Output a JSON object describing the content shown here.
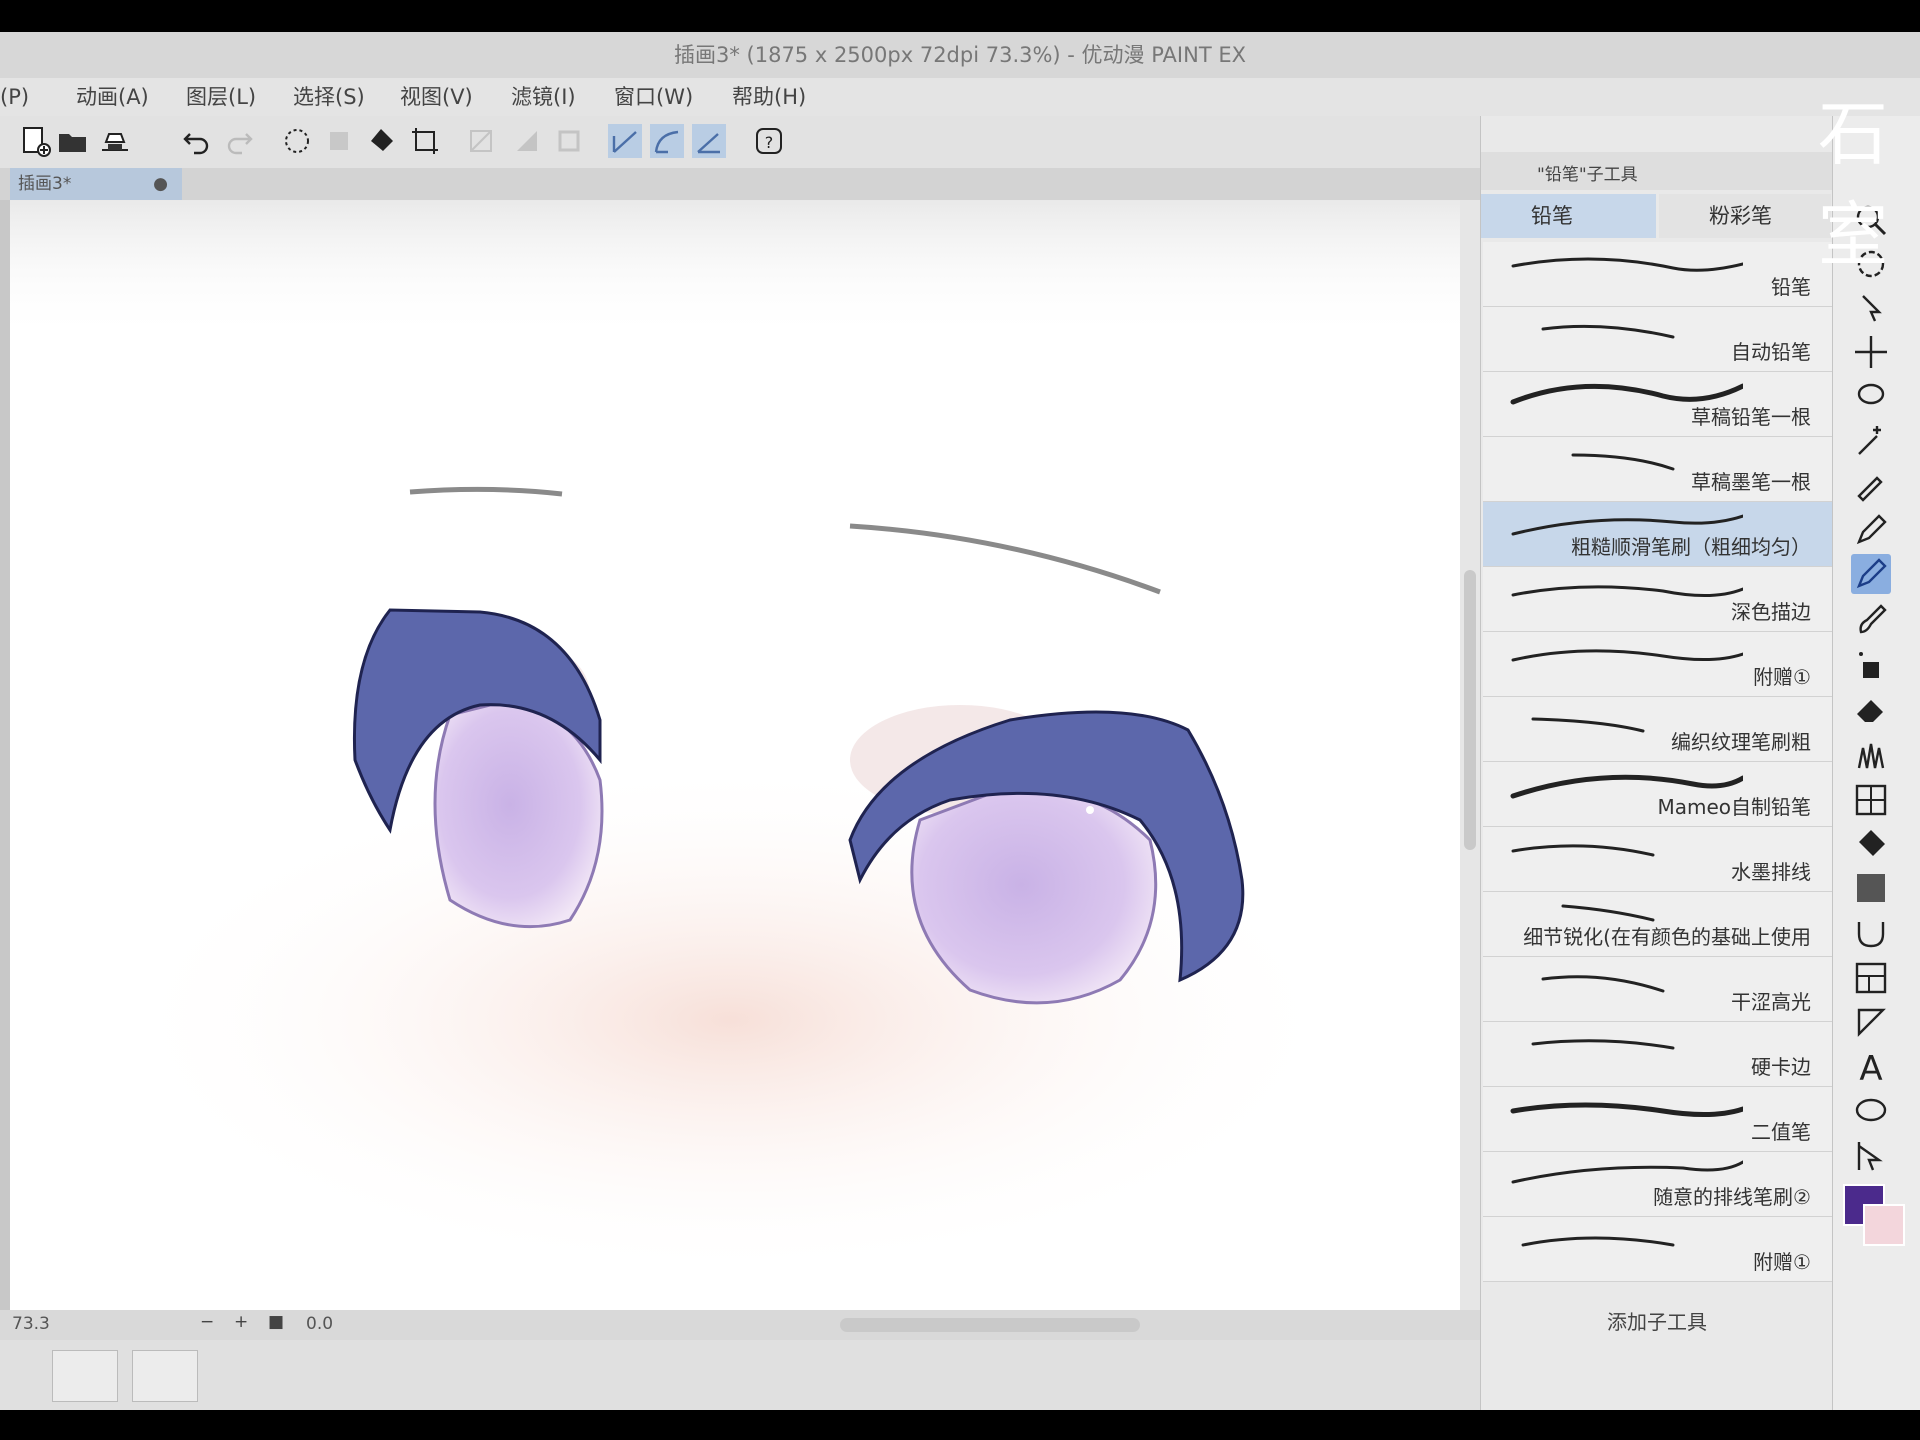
{
  "window": {
    "title": "插画3* (1875 x 2500px 72dpi 73.3%)  - 优动漫 PAINT EX"
  },
  "menu": [
    "(P)",
    "动画(A)",
    "图层(L)",
    "选择(S)",
    "视图(V)",
    "滤镜(I)",
    "窗口(W)",
    "帮助(H)"
  ],
  "document_tab": {
    "label": "插画3*"
  },
  "status": {
    "zoom": "73.3",
    "rotation": "0.0"
  },
  "subtool_panel": {
    "header": "\"铅笔\"子工具",
    "tabs": [
      "铅笔",
      "粉彩笔"
    ],
    "brushes": [
      "铅笔",
      "自动铅笔",
      "草稿铅笔一根",
      "草稿墨笔一根",
      "粗糙顺滑笔刷（粗细均匀）",
      "深色描边",
      "附赠①",
      "编织纹理笔刷粗",
      "Mameo自制铅笔",
      "水墨排线",
      "细节锐化(在有颜色的基础上使用",
      "干涩高光",
      "硬卡边",
      "二值笔",
      "随意的排线笔刷②",
      "附赠①"
    ],
    "selected_index": 4,
    "add_label": "添加子工具"
  },
  "colors": {
    "main": "#4b2a8c",
    "sub": "#f3d6dc",
    "accent": "#6f97d9"
  },
  "watermark": "石室"
}
